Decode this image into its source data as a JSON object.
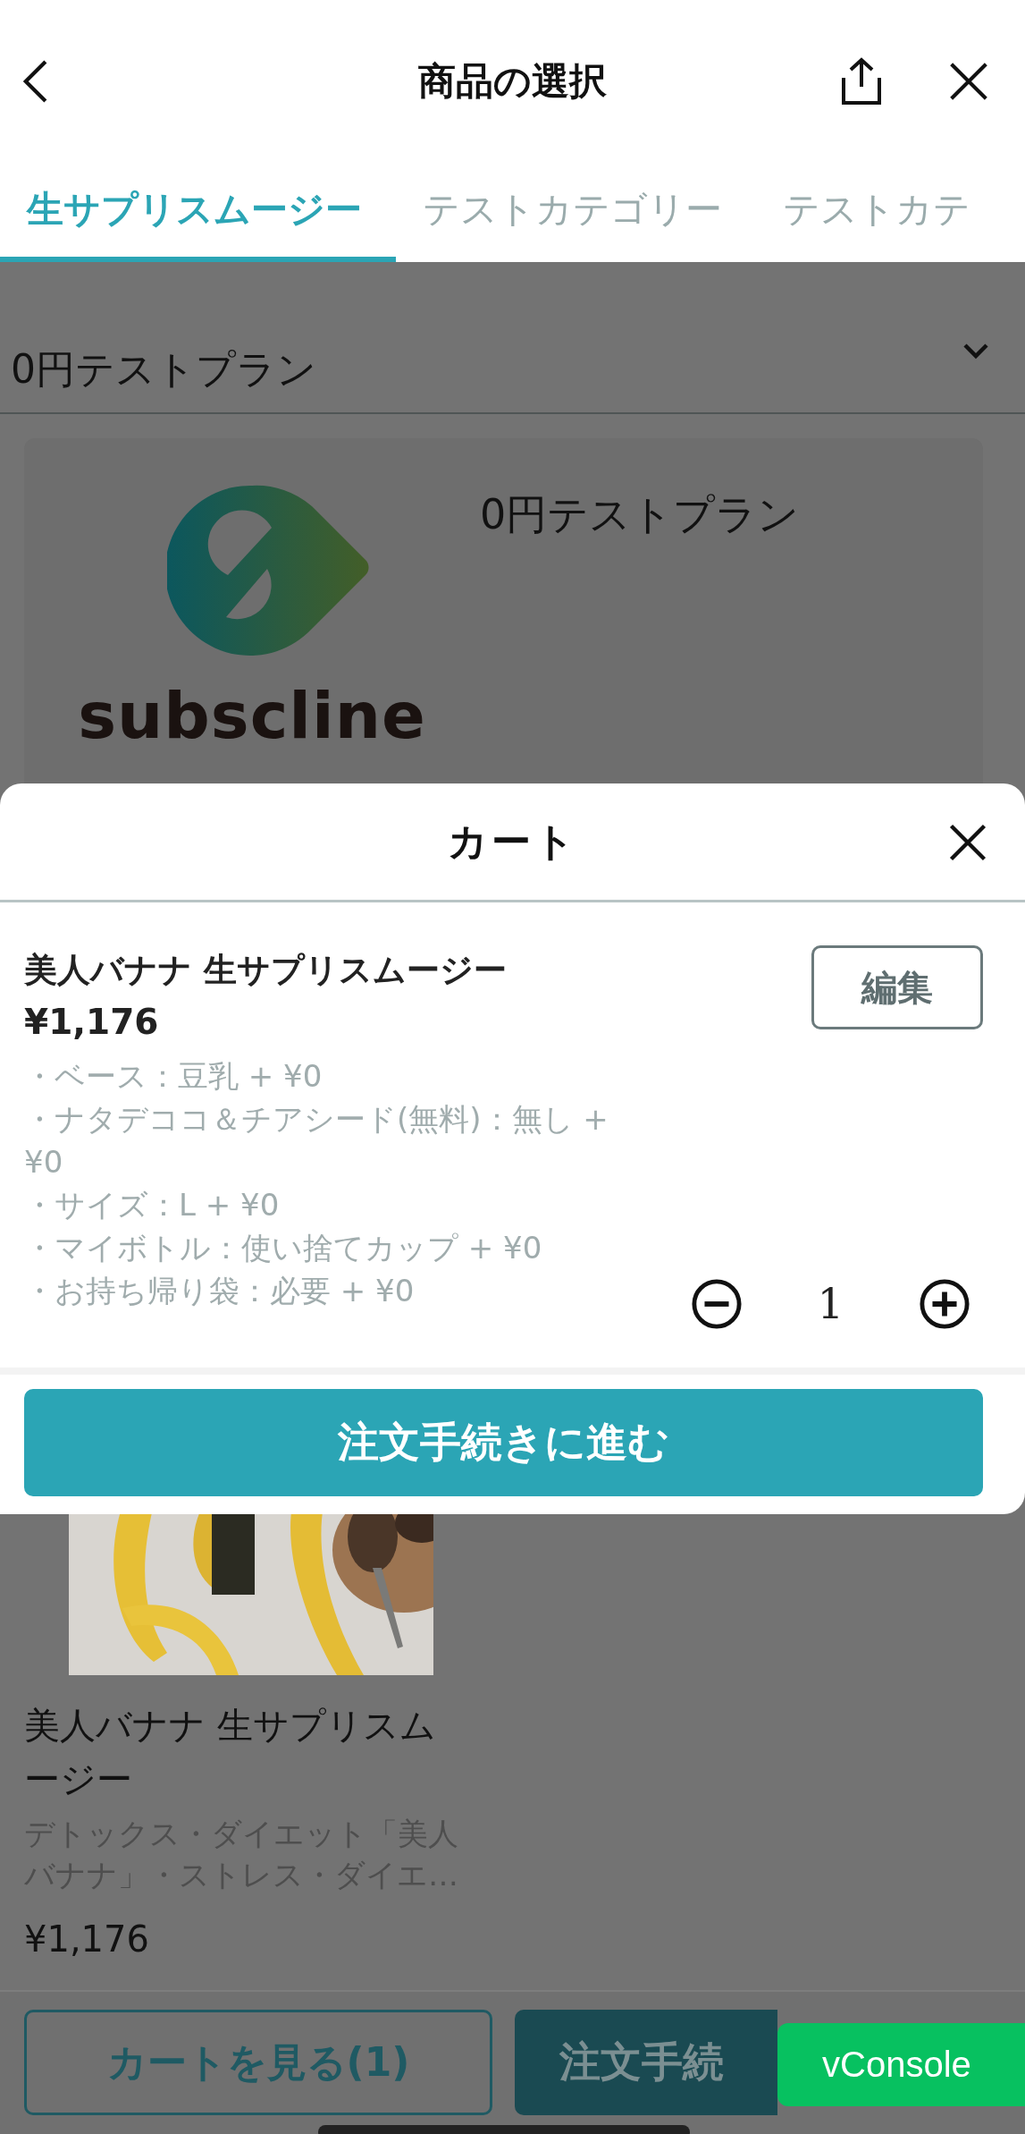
{
  "header": {
    "title": "商品の選択"
  },
  "tabs": [
    {
      "label": "生サプリスムージー",
      "selected": true
    },
    {
      "label": "テストカテゴリー",
      "selected": false
    },
    {
      "label": "テストカテ",
      "selected": false
    }
  ],
  "plan_select": {
    "value": "0円テストプラン"
  },
  "plan_card": {
    "logo_text": "subscline",
    "name": "0円テストプラン"
  },
  "product": {
    "name": "美人バナナ 生サプリスムージー",
    "description": "デトックス・ダイエット「美人バナナ」・ストレス・ダイエ…",
    "price": "¥1,176"
  },
  "bottom_bar": {
    "cart_button": "カートを見る(1)",
    "checkout_button": "注文手続"
  },
  "cart": {
    "title": "カート",
    "items": [
      {
        "name": "美人バナナ 生サプリスムージー",
        "price": "¥1,176",
        "edit_button": "編集",
        "quantity": "1",
        "options": [
          "・ベース：豆乳 + ¥0",
          "・ナタデココ＆チアシード(無料)：無し + ¥0",
          "・サイズ：L + ¥0",
          "・マイボトル：使い捨てカップ + ¥0",
          "・お持ち帰り袋：必要 + ¥0"
        ]
      }
    ],
    "checkout_button": "注文手続きに進む"
  },
  "vconsole_button": "vConsole"
}
